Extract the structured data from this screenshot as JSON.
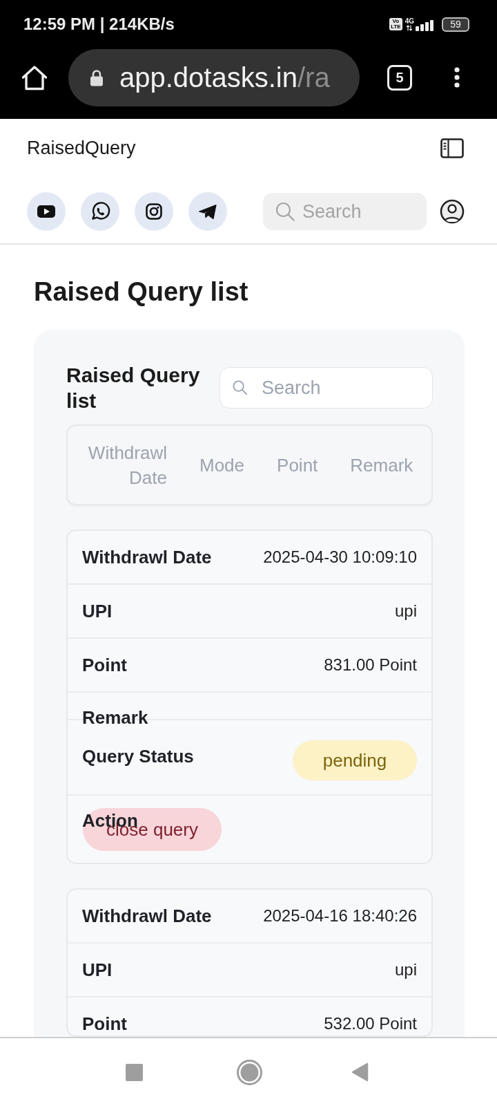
{
  "status_bar": {
    "time": "12:59 PM | 214KB/s",
    "volte": [
      "Vo",
      "LTE"
    ],
    "network": "4G",
    "battery": "59"
  },
  "browser": {
    "address": {
      "host": "app.dotasks.in",
      "path": "/ra"
    },
    "tab_count": "5"
  },
  "app_bar": {
    "title": "RaisedQuery"
  },
  "header": {
    "social_links": [
      {
        "kind": "video"
      },
      {
        "kind": "chat"
      },
      {
        "kind": "camera"
      },
      {
        "kind": "send"
      }
    ],
    "search": {
      "placeholder": "Search"
    }
  },
  "page": {
    "title": "Raised Query list"
  },
  "panel": {
    "title": "Raised Query list",
    "search": {
      "placeholder": "Search"
    },
    "columns": [
      "Withdrawl Date",
      "Mode",
      "Point",
      "Remark"
    ],
    "records": [
      {
        "fields": [
          {
            "kind": "text",
            "label": "Withdrawl Date",
            "value": "2025-04-30 10:09:10"
          },
          {
            "kind": "text",
            "label": "UPI",
            "value": "upi"
          },
          {
            "kind": "text",
            "label": "Point",
            "value": "831.00 Point"
          },
          {
            "kind": "blank",
            "label": "Remark"
          },
          {
            "kind": "status",
            "label": "Query Status",
            "value": "pending"
          },
          {
            "kind": "action",
            "label": "Action",
            "value": "close query"
          }
        ]
      },
      {
        "fields": [
          {
            "kind": "text",
            "label": "Withdrawl Date",
            "value": "2025-04-16 18:40:26"
          },
          {
            "kind": "text",
            "label": "UPI",
            "value": "upi"
          },
          {
            "kind": "text",
            "label": "Point",
            "value": "532.00 Point"
          }
        ]
      }
    ]
  }
}
